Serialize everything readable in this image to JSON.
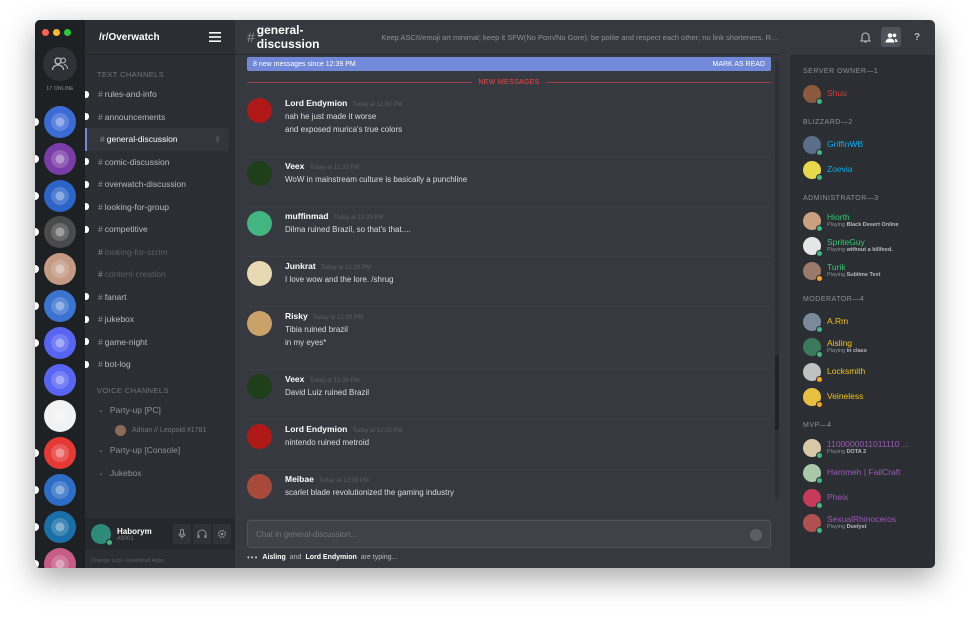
{
  "window": {
    "traffic_colors": [
      "#ff5f57",
      "#febc2e",
      "#28c840"
    ]
  },
  "rail": {
    "online_count": "17 ONLINE",
    "servers": [
      {
        "color": "#3d6bd6",
        "icon": "discord-app-icon",
        "pip": true
      },
      {
        "color": "#7a3da8",
        "icon": "swirl-icon",
        "pip": true
      },
      {
        "color": "#2d64c8",
        "icon": "reddit-icon",
        "pip": true
      },
      {
        "color": "#4a4a4a",
        "icon": "tech-icon",
        "pip": true
      },
      {
        "color": "#c49a84",
        "icon": "portrait-icon",
        "pip": true
      },
      {
        "color": "#3b73d0",
        "icon": "hots-icon",
        "pip": true
      },
      {
        "color": "#5865f2",
        "icon": "discord-api-icon",
        "pip": true
      },
      {
        "color": "#5865f2",
        "icon": "dapi-icon",
        "pip": false
      },
      {
        "color": "#f2f2f2",
        "icon": "script-logo-icon",
        "pip": false
      },
      {
        "color": "#e53935",
        "icon": "hammers-icon",
        "pip": true
      },
      {
        "color": "#2d6dc6",
        "icon": "hots-icon",
        "pip": true
      },
      {
        "color": "#1a6fa8",
        "icon": "lf-icon",
        "pip": true
      },
      {
        "color": "#c75b88",
        "icon": "girl-portrait-icon",
        "pip": true
      }
    ]
  },
  "guild": {
    "name": "/r/Overwatch",
    "text_category": "TEXT CHANNELS",
    "voice_category": "VOICE CHANNELS",
    "text_channels": [
      {
        "name": "rules-and-info",
        "state": "unread"
      },
      {
        "name": "announcements",
        "state": "unread"
      },
      {
        "name": "general-discussion",
        "state": "active"
      },
      {
        "name": "comic-discussion",
        "state": "unread"
      },
      {
        "name": "overwatch-discussion",
        "state": "unread"
      },
      {
        "name": "looking-for-group",
        "state": "unread"
      },
      {
        "name": "competitive",
        "state": "unread"
      },
      {
        "name": "looking-for-scrim",
        "state": "muted"
      },
      {
        "name": "content-creation",
        "state": "muted"
      },
      {
        "name": "fanart",
        "state": "unread"
      },
      {
        "name": "jukebox",
        "state": "unread"
      },
      {
        "name": "game-night",
        "state": "unread"
      },
      {
        "name": "bot-log",
        "state": "unread"
      }
    ],
    "voice_channels": [
      {
        "name": "Party-up [PC]",
        "users": [
          "Adrian // Leopold #1781"
        ]
      },
      {
        "name": "Party-up [Console]",
        "users": []
      },
      {
        "name": "Jukebox",
        "users": []
      }
    ]
  },
  "user_panel": {
    "name": "Haborym",
    "tag": "#9001",
    "footer": "Change Log  •  Download Apps"
  },
  "chat": {
    "hash": "#",
    "channel": "general-discussion",
    "topic": "Keep ASCII/emoji art minimal; keep it SFW(No Porn/No Gore); be polite and respect each other; no link shorteners. Rul...",
    "new_messages_text": "8 new messages since 12:39 PM",
    "mark_as_read": "MARK AS READ",
    "divider": "NEW MESSAGES",
    "messages": [
      {
        "author": "Lord Endymion",
        "time": "Today at 12:39 PM",
        "avatar": "#b01818",
        "lines": [
          "nah he just made it worse",
          "and exposed murica's true colors"
        ]
      },
      {
        "author": "Veex",
        "time": "Today at 12:39 PM",
        "avatar": "#1f3f1a",
        "lines": [
          "WoW in mainstream culture is basically a punchline"
        ]
      },
      {
        "author": "muffinmad",
        "time": "Today at 12:39 PM",
        "avatar": "#43b581",
        "lines": [
          "Dilma ruined Brazil, so that's that...."
        ]
      },
      {
        "author": "Junkrat",
        "time": "Today at 12:39 PM",
        "avatar": "#e8d9b5",
        "lines": [
          "I love wow and the lore. /shrug"
        ]
      },
      {
        "author": "Risky",
        "time": "Today at 12:39 PM",
        "avatar": "#c9a26a",
        "lines": [
          "Tibia ruined brazil",
          "in my eyes*"
        ]
      },
      {
        "author": "Veex",
        "time": "Today at 12:39 PM",
        "avatar": "#1f3f1a",
        "lines": [
          "David Luiz ruined Brazil"
        ]
      },
      {
        "author": "Lord Endymion",
        "time": "Today at 12:39 PM",
        "avatar": "#b01818",
        "lines": [
          "nintendo ruined metroid"
        ]
      },
      {
        "author": "Meibae",
        "time": "Today at 12:39 PM",
        "avatar": "#a84a3a",
        "lines": [
          "scarlet blade revolutionized the gaming industry"
        ]
      }
    ],
    "input_placeholder": "Chat in general-discussion...",
    "typing_user1": "Aisling",
    "typing_and": "and",
    "typing_user2": "Lord Endymion",
    "typing_suffix": "are typing..."
  },
  "members": {
    "groups": [
      {
        "role": "SERVER OWNER—1",
        "members": [
          {
            "name": "Shuu",
            "color": "#e53935",
            "avatar": "#8b5a3c",
            "status": "#43b581",
            "game": ""
          }
        ]
      },
      {
        "role": "BLIZZARD—2",
        "members": [
          {
            "name": "GriffinWB",
            "color": "#00b0f4",
            "avatar": "#5a6e8a",
            "status": "#43b581",
            "game": ""
          },
          {
            "name": "Zoevia",
            "color": "#00b0f4",
            "avatar": "#e8d84a",
            "status": "#43b581",
            "game": ""
          }
        ]
      },
      {
        "role": "ADMINISTRATOR—3",
        "members": [
          {
            "name": "Hiorth",
            "color": "#2ecc71",
            "avatar": "#c9a080",
            "status": "#43b581",
            "game_prefix": "Playing",
            "game": "Black Desert Online"
          },
          {
            "name": "SpriteGuy",
            "color": "#2ecc71",
            "avatar": "#e6e6e6",
            "status": "#43b581",
            "game_prefix": "Playing",
            "game": "without a killfeed."
          },
          {
            "name": "Turik",
            "color": "#2ecc71",
            "avatar": "#9a7a6a",
            "status": "#faa61a",
            "game_prefix": "Playing",
            "game": "Sublime Text"
          }
        ]
      },
      {
        "role": "MODERATOR—4",
        "members": [
          {
            "name": "A.Rm",
            "color": "#f1c40f",
            "avatar": "#7a8a9a",
            "status": "#43b581",
            "game": ""
          },
          {
            "name": "Aisling",
            "color": "#f1c40f",
            "avatar": "#3a7a5a",
            "status": "#43b581",
            "game_prefix": "Playing",
            "game": "in class"
          },
          {
            "name": "Locksmith",
            "color": "#f1c40f",
            "avatar": "#c0c0c0",
            "status": "#faa61a",
            "game": ""
          },
          {
            "name": "Veineless",
            "color": "#f1c40f",
            "avatar": "#e8c040",
            "status": "#faa61a",
            "game": ""
          }
        ]
      },
      {
        "role": "MVP—4",
        "members": [
          {
            "name": "1100000011011110 ...",
            "color": "#9b59b6",
            "avatar": "#d8c8a8",
            "status": "#43b581",
            "game_prefix": "Playing",
            "game": "DOTA 2"
          },
          {
            "name": "Hammeh | FailCraft",
            "color": "#9b59b6",
            "avatar": "#a8c8a8",
            "status": "#43b581",
            "game": ""
          },
          {
            "name": "Pheix",
            "color": "#9b59b6",
            "avatar": "#c83a5a",
            "status": "#43b581",
            "game": ""
          },
          {
            "name": "SexualRhinoceros",
            "color": "#9b59b6",
            "avatar": "#b05050",
            "status": "#43b581",
            "game_prefix": "Playing",
            "game": "Duelyst"
          }
        ]
      }
    ]
  }
}
